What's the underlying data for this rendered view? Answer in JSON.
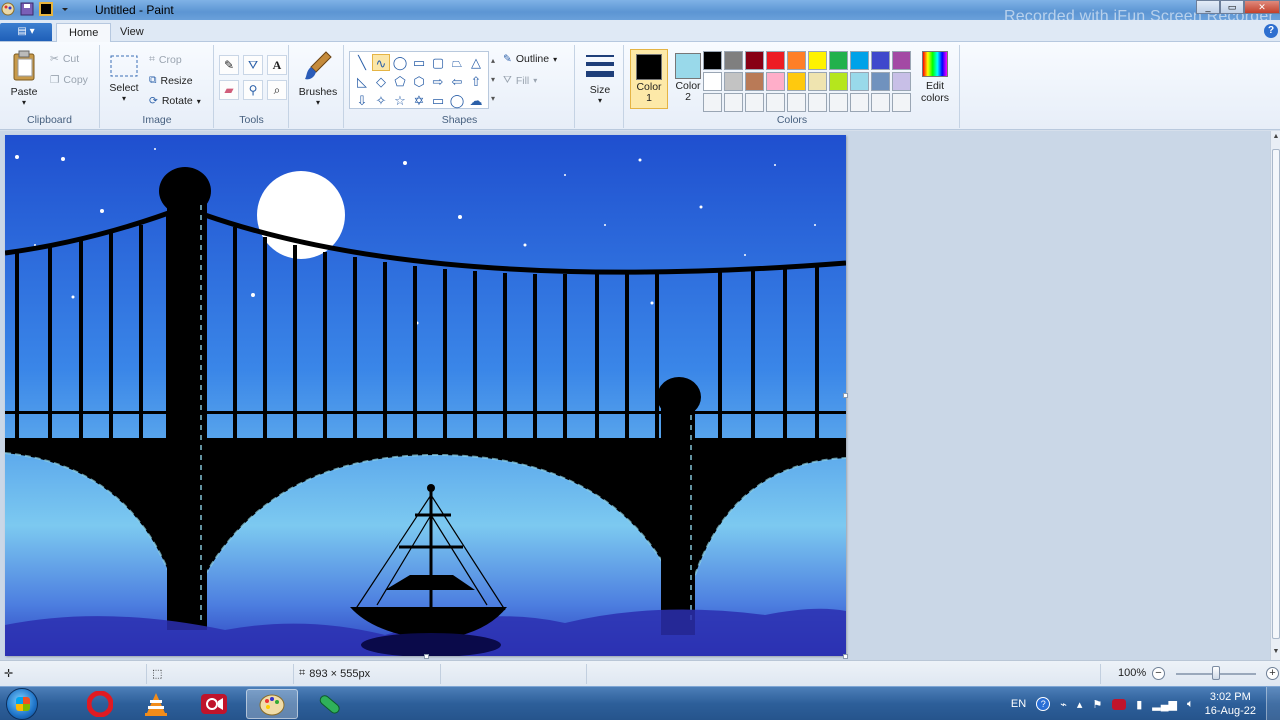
{
  "window": {
    "title": "Untitled - Paint",
    "watermark": "Recorded with iFun Screen Recorder"
  },
  "tabs": [
    {
      "label": "Home",
      "active": true
    },
    {
      "label": "View",
      "active": false
    }
  ],
  "clipboard": {
    "group": "Clipboard",
    "paste": "Paste",
    "cut": "Cut",
    "copy": "Copy"
  },
  "image": {
    "group": "Image",
    "select": "Select",
    "crop": "Crop",
    "resize": "Resize",
    "rotate": "Rotate"
  },
  "tools": {
    "group": "Tools",
    "text_glyph": "A"
  },
  "brushes": {
    "label": "Brushes"
  },
  "shapes": {
    "group": "Shapes",
    "outline": "Outline",
    "fill": "Fill"
  },
  "size": {
    "label": "Size"
  },
  "colors": {
    "group": "Colors",
    "color1_label": "Color",
    "color1_num": "1",
    "color2_label": "Color",
    "color2_num": "2",
    "color1": "#000000",
    "color2": "#99d9ea",
    "edit_label": "Edit",
    "edit_label2": "colors",
    "palette": [
      "#000000",
      "#7f7f7f",
      "#880015",
      "#ed1c24",
      "#ff7f27",
      "#fff200",
      "#22b14c",
      "#00a2e8",
      "#3f48cc",
      "#a349a4",
      "#ffffff",
      "#c3c3c3",
      "#b97a57",
      "#ffaec9",
      "#ffc90e",
      "#efe4b0",
      "#b5e61d",
      "#99d9ea",
      "#7092be",
      "#c8bfe7",
      "#f2f4f7",
      "#f2f4f7",
      "#f2f4f7",
      "#f2f4f7",
      "#f2f4f7",
      "#f2f4f7",
      "#f2f4f7",
      "#f2f4f7",
      "#f2f4f7",
      "#f2f4f7"
    ]
  },
  "status": {
    "dimensions": "893 × 555px",
    "zoom": "100%"
  },
  "tray": {
    "lang": "EN",
    "time": "3:02 PM",
    "date": "16-Aug-22"
  }
}
